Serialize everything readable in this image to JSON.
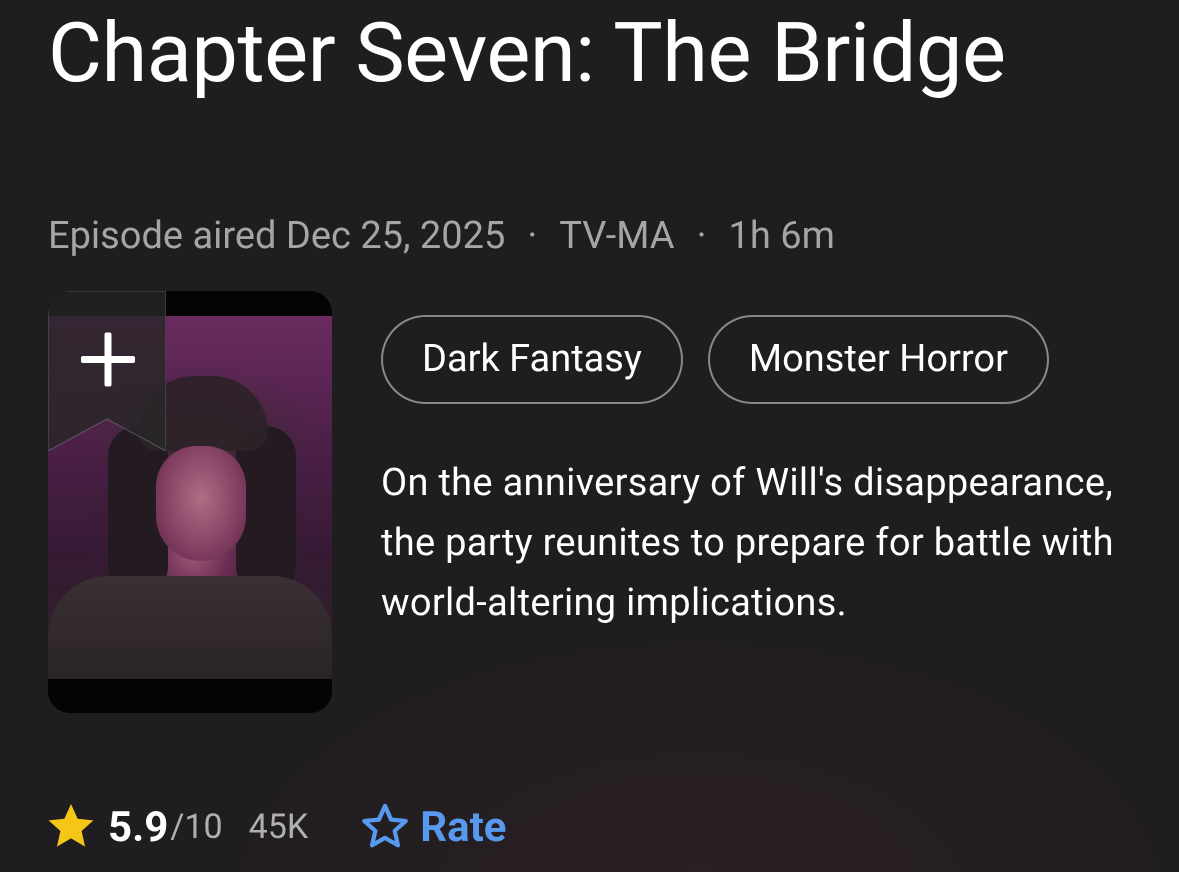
{
  "episode": {
    "title": "Chapter Seven: The Bridge",
    "aired": "Episode aired Dec 25, 2025",
    "separator": "·",
    "rating_certificate": "TV-MA",
    "runtime": "1h 6m"
  },
  "poster": {
    "watchlist_icon": "plus-icon",
    "bookmark_icon": "ribbon-bookmark-icon"
  },
  "genres": [
    "Dark Fantasy",
    "Monster Horror"
  ],
  "description": "On the anniversary of Will's disappearance, the party reunites to prepare for battle with world-altering implications.",
  "rating": {
    "icon": "star-icon",
    "score": "5.9",
    "out_of": "/10",
    "votes": "45K",
    "star_color": "#f5c518"
  },
  "rate": {
    "icon": "star-outline-icon",
    "label": "Rate",
    "color": "#5799ef"
  }
}
